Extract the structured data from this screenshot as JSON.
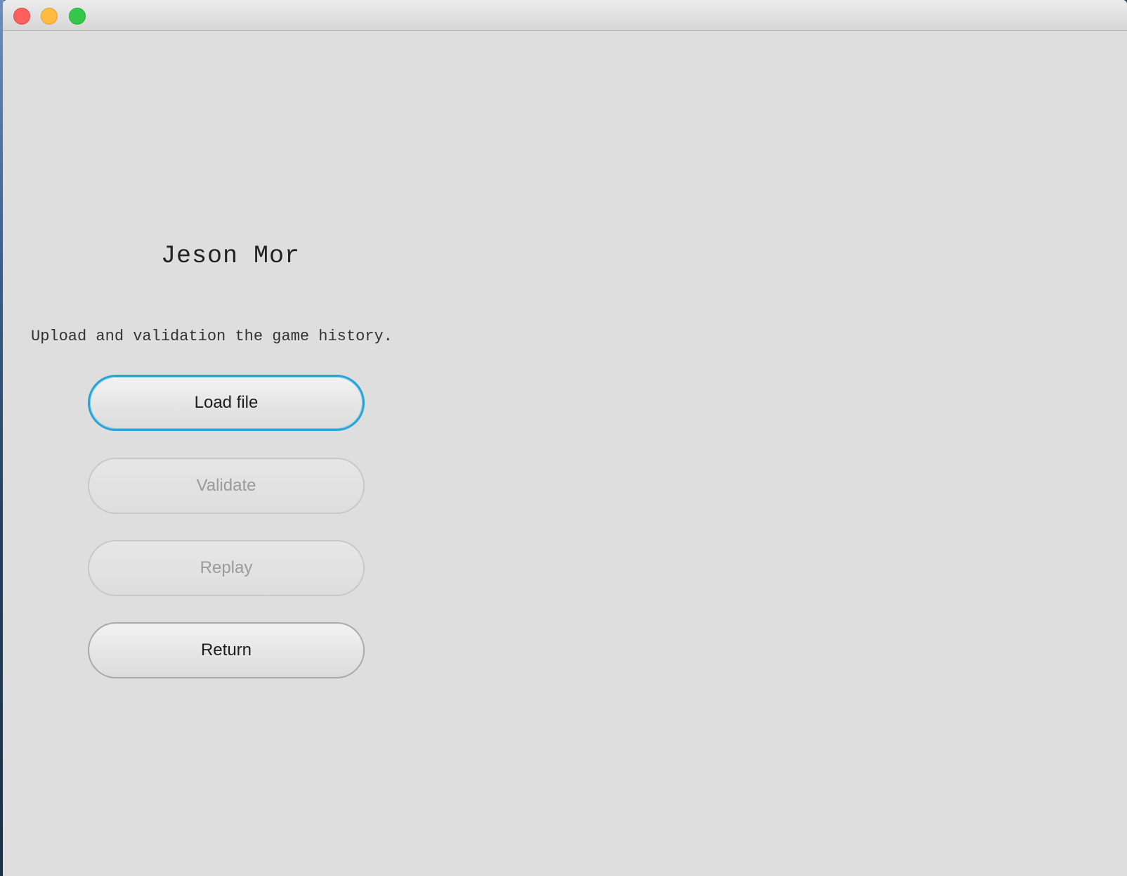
{
  "window": {
    "controls": [
      "close",
      "minimize",
      "zoom"
    ]
  },
  "main": {
    "title": "Jeson Mor",
    "subtitle": "Upload and validation the game history.",
    "buttons": {
      "load_file": "Load file",
      "validate": "Validate",
      "replay": "Replay",
      "return": "Return"
    }
  },
  "colors": {
    "background": "#dedede",
    "focus_ring": "#2aa3d8",
    "close": "#fc605c",
    "minimize": "#fdbc40",
    "zoom": "#34c84a",
    "disabled_text": "#9a9a9a"
  }
}
